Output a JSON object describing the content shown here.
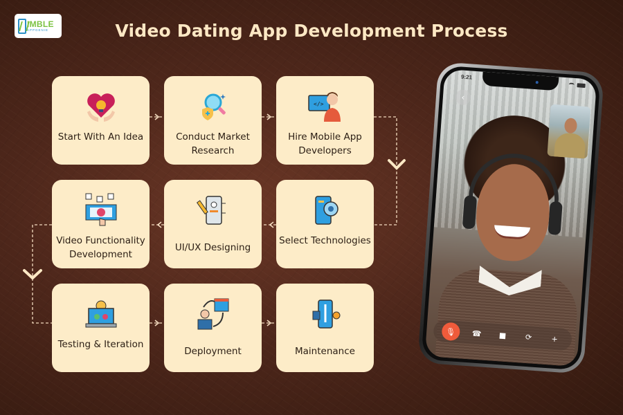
{
  "logo": {
    "main": "IMBLE",
    "sub": "APPGENIE"
  },
  "title": "Video Dating App Development Process",
  "colors": {
    "card": "#fdecc8",
    "title": "#fde8c4",
    "connector": "#f4dcc0",
    "mute_button": "#ef5b3b"
  },
  "steps": [
    {
      "label": "Start With An Idea",
      "icon": "heart-lightbulb-hands-icon"
    },
    {
      "label": "Conduct Market Research",
      "icon": "magnifier-shield-icon"
    },
    {
      "label": "Hire Mobile App Developers",
      "icon": "developer-monitor-icon"
    },
    {
      "label": "Select Technologies",
      "icon": "phone-gear-icon"
    },
    {
      "label": "UI/UX Designing",
      "icon": "phone-pencil-icon"
    },
    {
      "label": "Video Functionality Development",
      "icon": "video-play-hand-icon"
    },
    {
      "label": "Testing & Iteration",
      "icon": "laptop-gear-check-icon"
    },
    {
      "label": "Deployment",
      "icon": "person-code-cycle-icon"
    },
    {
      "label": "Maintenance",
      "icon": "phone-wrench-gear-icon"
    }
  ],
  "phone": {
    "status_time": "9:21",
    "back_label": "‹",
    "call_controls": [
      {
        "name": "mute",
        "glyph": "🎙"
      },
      {
        "name": "end-call",
        "glyph": "☎"
      },
      {
        "name": "video",
        "glyph": "■"
      },
      {
        "name": "flip-camera",
        "glyph": "⟳"
      },
      {
        "name": "add",
        "glyph": "+"
      }
    ]
  }
}
